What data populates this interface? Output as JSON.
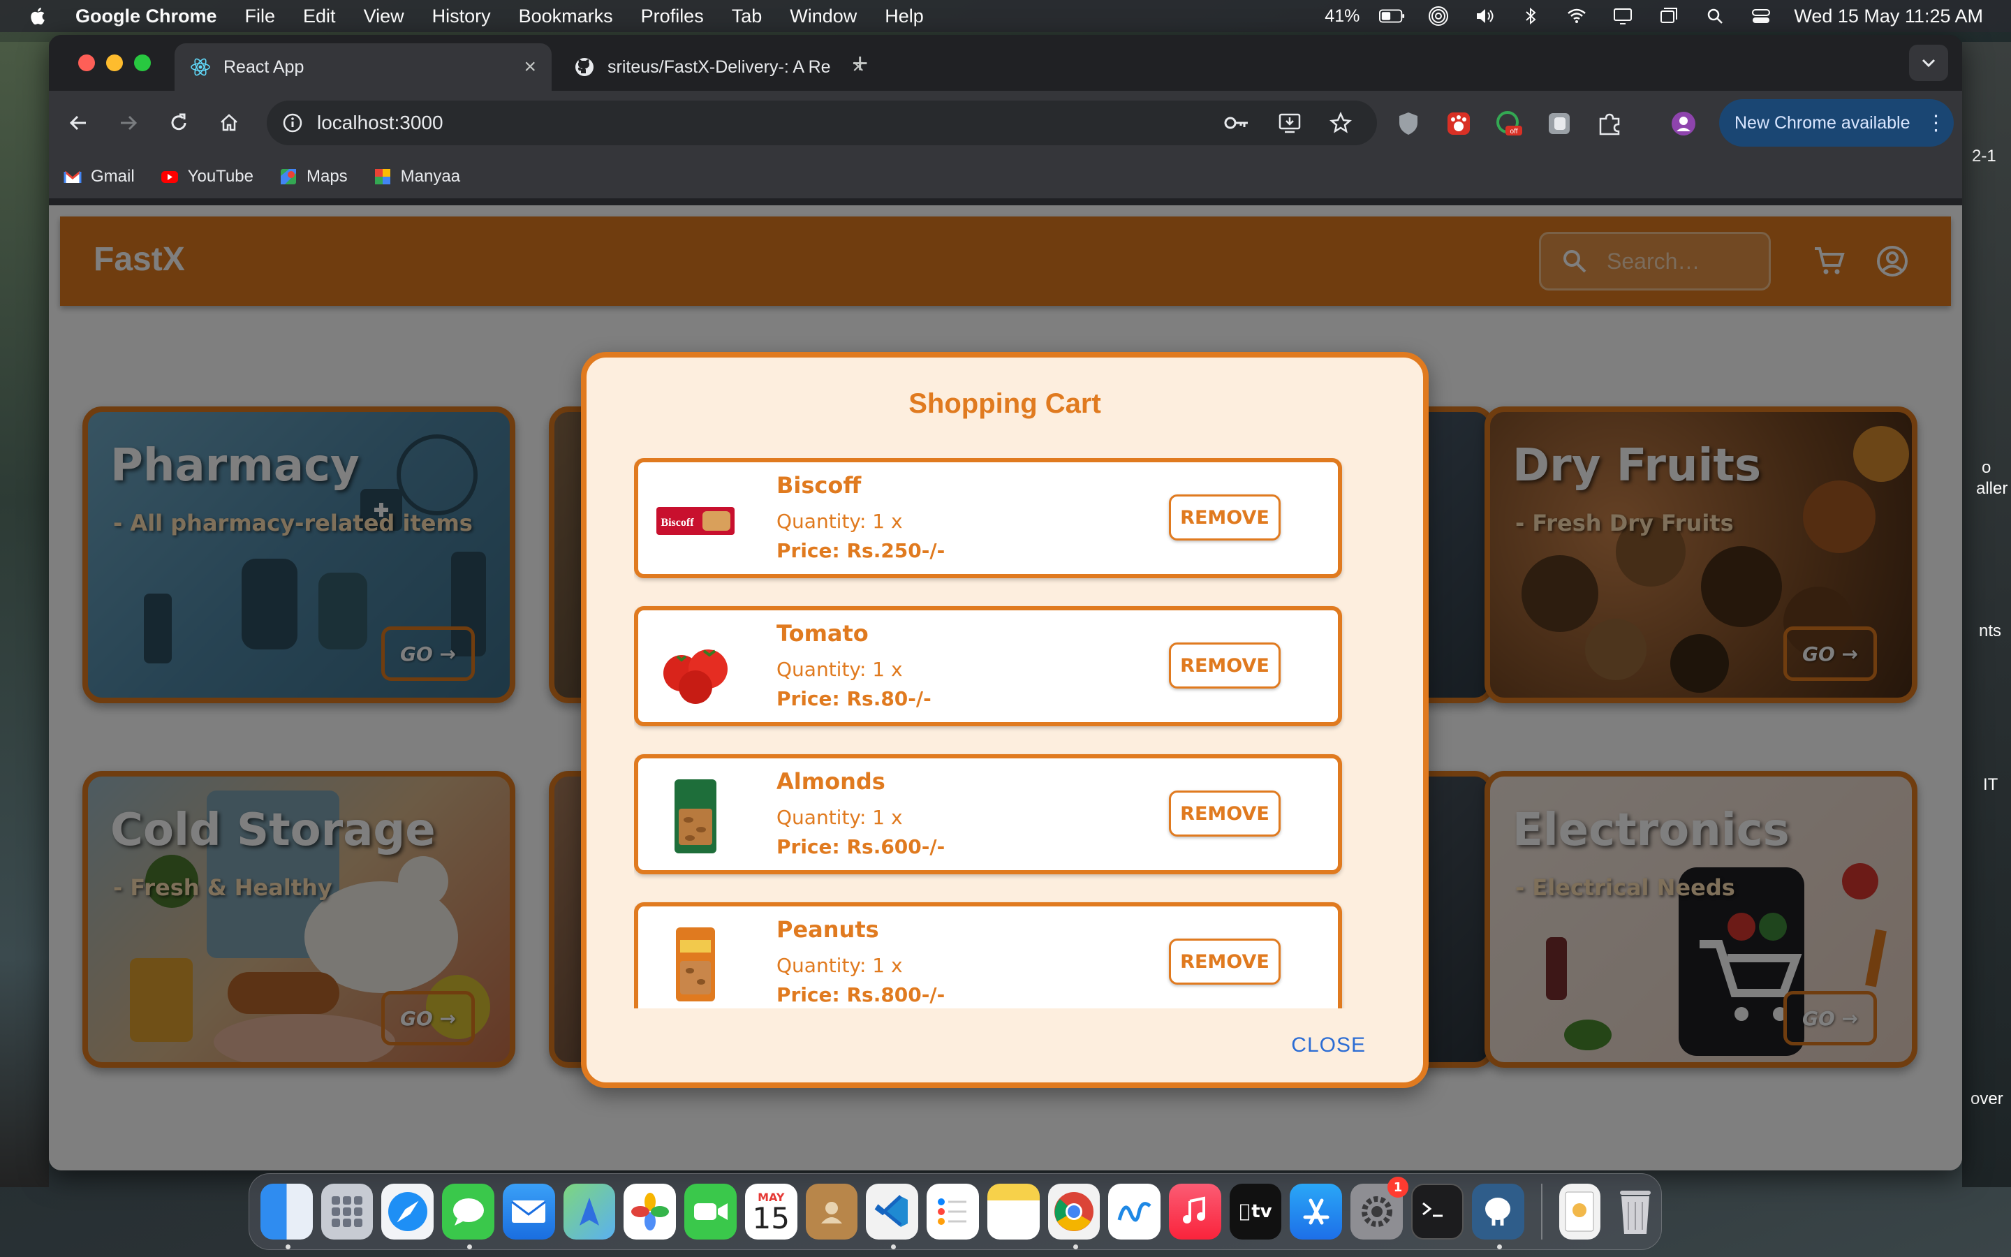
{
  "menubar": {
    "app_name": "Google Chrome",
    "items": [
      "File",
      "Edit",
      "View",
      "History",
      "Bookmarks",
      "Profiles",
      "Tab",
      "Window",
      "Help"
    ],
    "battery": "41%",
    "datetime": "Wed 15 May  11:25 AM"
  },
  "tabs": [
    {
      "title": "React App"
    },
    {
      "title": "sriteus/FastX-Delivery-: A Re"
    }
  ],
  "toolbar": {
    "url": "localhost:3000",
    "update_label": "New Chrome available"
  },
  "bookmarks": [
    "Gmail",
    "YouTube",
    "Maps",
    "Manyaa"
  ],
  "app": {
    "brand": "FastX",
    "search_placeholder": "Search…"
  },
  "categories": [
    {
      "title": "Pharmacy",
      "subtitle": "- All pharmacy-related items",
      "go": "GO →"
    },
    {
      "title": "Dry Fruits",
      "subtitle": "- Fresh Dry Fruits",
      "go": "GO →"
    },
    {
      "title": "Cold Storage",
      "subtitle": "- Fresh & Healthy",
      "go": "GO →"
    },
    {
      "title": "Electronics",
      "subtitle": "- Electrical Needs",
      "go": "GO →"
    }
  ],
  "cart": {
    "title": "Shopping Cart",
    "remove_label": "REMOVE",
    "close_label": "CLOSE",
    "items": [
      {
        "name": "Biscoff",
        "quantity": "Quantity: 1 x",
        "price": "Price: Rs.250-/-"
      },
      {
        "name": "Tomato",
        "quantity": "Quantity: 1 x",
        "price": "Price: Rs.80-/-"
      },
      {
        "name": "Almonds",
        "quantity": "Quantity: 1 x",
        "price": "Price: Rs.600-/-"
      },
      {
        "name": "Peanuts",
        "quantity": "Quantity: 1 x",
        "price": "Price: Rs.800-/-"
      }
    ]
  },
  "dock": {
    "calendar_month": "MAY",
    "calendar_day": "15",
    "settings_badge": "1",
    "tv_label": "tv"
  },
  "desktop_edge": [
    "2-1",
    "o",
    "aller",
    "nts",
    "IT",
    "over"
  ],
  "colors": {
    "accent": "#e07a1f",
    "modal_bg": "#fdeede",
    "close_link": "#2b6cd4"
  }
}
